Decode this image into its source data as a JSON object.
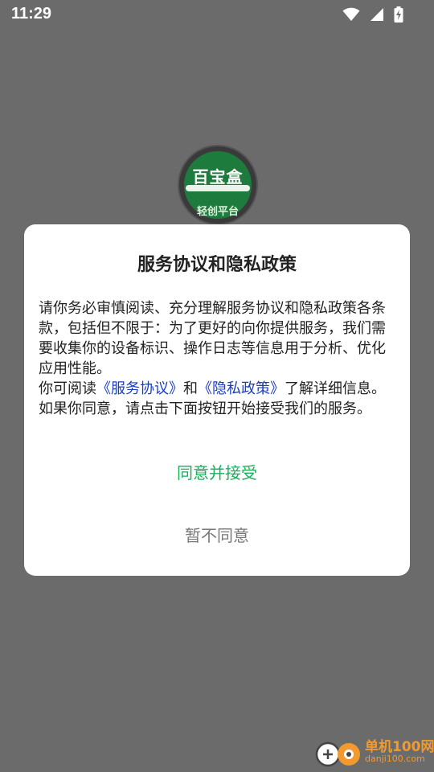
{
  "status_bar": {
    "time": "11:29",
    "icons": [
      "wifi-icon",
      "cell-signal-icon",
      "battery-charging-icon"
    ]
  },
  "app_logo": {
    "title": "百宝盒",
    "subtitle": "轻创平台"
  },
  "dialog": {
    "title": "服务协议和隐私政策",
    "body_paragraph_1": "请你务必审慎阅读、充分理解服务协议和隐私政策各条款，包括但不限于：为了更好的向你提供服务，我们需要收集你的设备标识、操作日志等信息用于分析、优化应用性能。",
    "body_paragraph_2_prefix": "你可阅读",
    "service_agreement_link": "《服务协议》",
    "conjunction": "和",
    "privacy_policy_link": "《隐私政策》",
    "body_paragraph_2_suffix": "了解详细信息。如果你同意，请点击下面按钮开始接受我们的服务。",
    "accept_label": "同意并接受",
    "decline_label": "暂不同意"
  },
  "watermark": {
    "name": "单机100网",
    "url": "danji100.com"
  },
  "colors": {
    "overlay": "#6b6b6b",
    "accent_green": "#18b05a",
    "link_blue": "#1a3cc8",
    "muted_gray": "#777777"
  }
}
